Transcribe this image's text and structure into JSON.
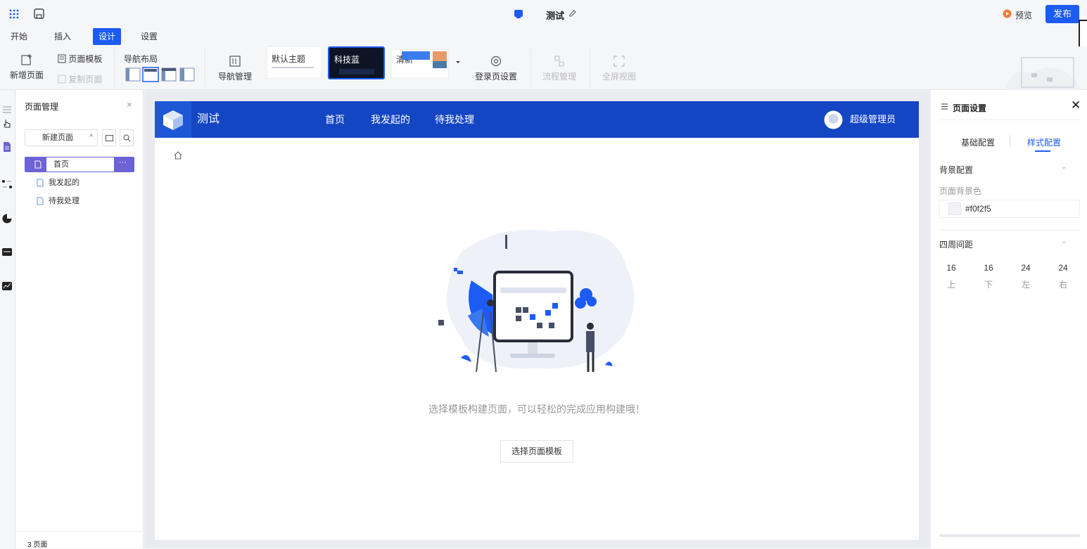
{
  "header": {
    "app_title": "测试",
    "preview_label": "预览",
    "publish_label": "发布"
  },
  "tabs": [
    "开始",
    "插入",
    "设计",
    "设置"
  ],
  "active_tab": "设计",
  "ribbon": {
    "add_page": "新增页面",
    "page_template": "页面模板",
    "copy_page": "复制页面",
    "nav_layout": "导航布局",
    "nav_manage": "导航管理",
    "theme_default": "默认主题",
    "theme_tech_blue": "科技蓝",
    "theme_fresh": "清新",
    "login_settings": "登录页设置",
    "flow_manage": "流程管理",
    "fullscreen_view": "全屏视图"
  },
  "page_panel": {
    "title": "页面管理",
    "new_page": "新建页面",
    "pages": [
      "首页",
      "我发起的",
      "待我处理"
    ],
    "footer": "3 页面"
  },
  "canvas": {
    "app_name": "测试",
    "nav": [
      "首页",
      "我发起的",
      "待我处理"
    ],
    "user": "超级管理员",
    "empty_text": "选择模板构建页面，可以轻松的完成应用构建哦！",
    "choose_button": "选择页面模板"
  },
  "settings": {
    "title": "页面设置",
    "tab_basic": "基础配置",
    "tab_style": "样式配置",
    "bg_section": "背景配置",
    "bg_color_label": "页面背景色",
    "bg_color_value": "#f0f2f5",
    "spacing_section": "四周间距",
    "spacing": [
      {
        "value": "16",
        "label": "上"
      },
      {
        "value": "16",
        "label": "下"
      },
      {
        "value": "24",
        "label": "左"
      },
      {
        "value": "24",
        "label": "右"
      }
    ]
  },
  "colors": {
    "accent": "#1d5bf5",
    "appbar": "#1446c4",
    "selected_page": "#6b63d6"
  }
}
